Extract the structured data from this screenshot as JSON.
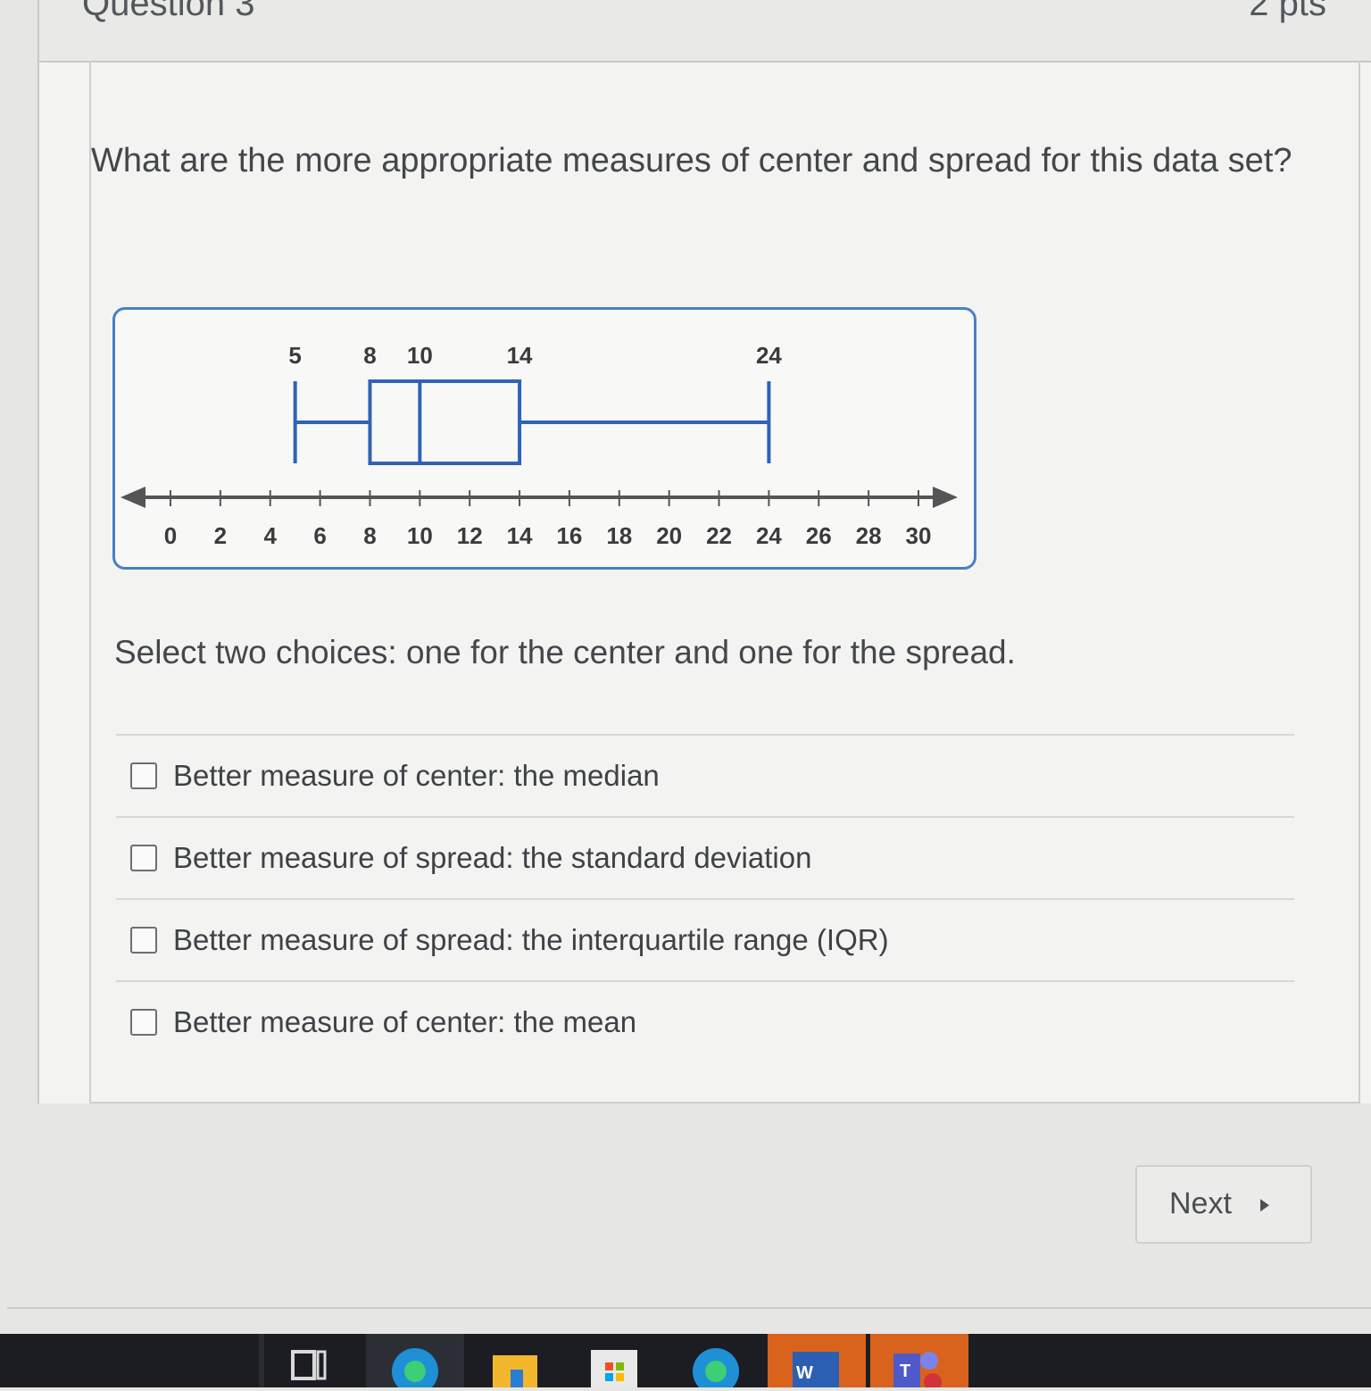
{
  "question": {
    "title": "Question 3",
    "points": "2 pts",
    "text": "What are the more appropriate measures of center and spread for this data set?",
    "instruction": "Select two choices: one for the center and one for the spread."
  },
  "chart_data": {
    "type": "box",
    "min": 5,
    "q1": 8,
    "median": 10,
    "q3": 14,
    "max": 24,
    "value_labels": [
      "5",
      "8",
      "10",
      "14",
      "24"
    ],
    "xlim": [
      0,
      30
    ],
    "x_ticks": [
      "0",
      "2",
      "4",
      "6",
      "8",
      "10",
      "12",
      "14",
      "16",
      "18",
      "20",
      "22",
      "24",
      "26",
      "28",
      "30"
    ],
    "color": "#2f62b8",
    "axis_color": "#555555"
  },
  "choices": [
    {
      "label": "Better measure of center: the median",
      "checked": false
    },
    {
      "label": "Better measure of spread: the standard deviation",
      "checked": false
    },
    {
      "label": "Better measure of spread: the interquartile range (IQR)",
      "checked": false
    },
    {
      "label": "Better measure of center: the mean",
      "checked": false
    }
  ],
  "navigation": {
    "next_label": "Next"
  },
  "taskbar": {
    "icons": [
      "task-view-icon",
      "edge-icon",
      "file-explorer-icon",
      "microsoft-store-icon",
      "edge-icon",
      "word-icon",
      "teams-icon"
    ],
    "word_letter": "W",
    "teams_letter": "T"
  }
}
